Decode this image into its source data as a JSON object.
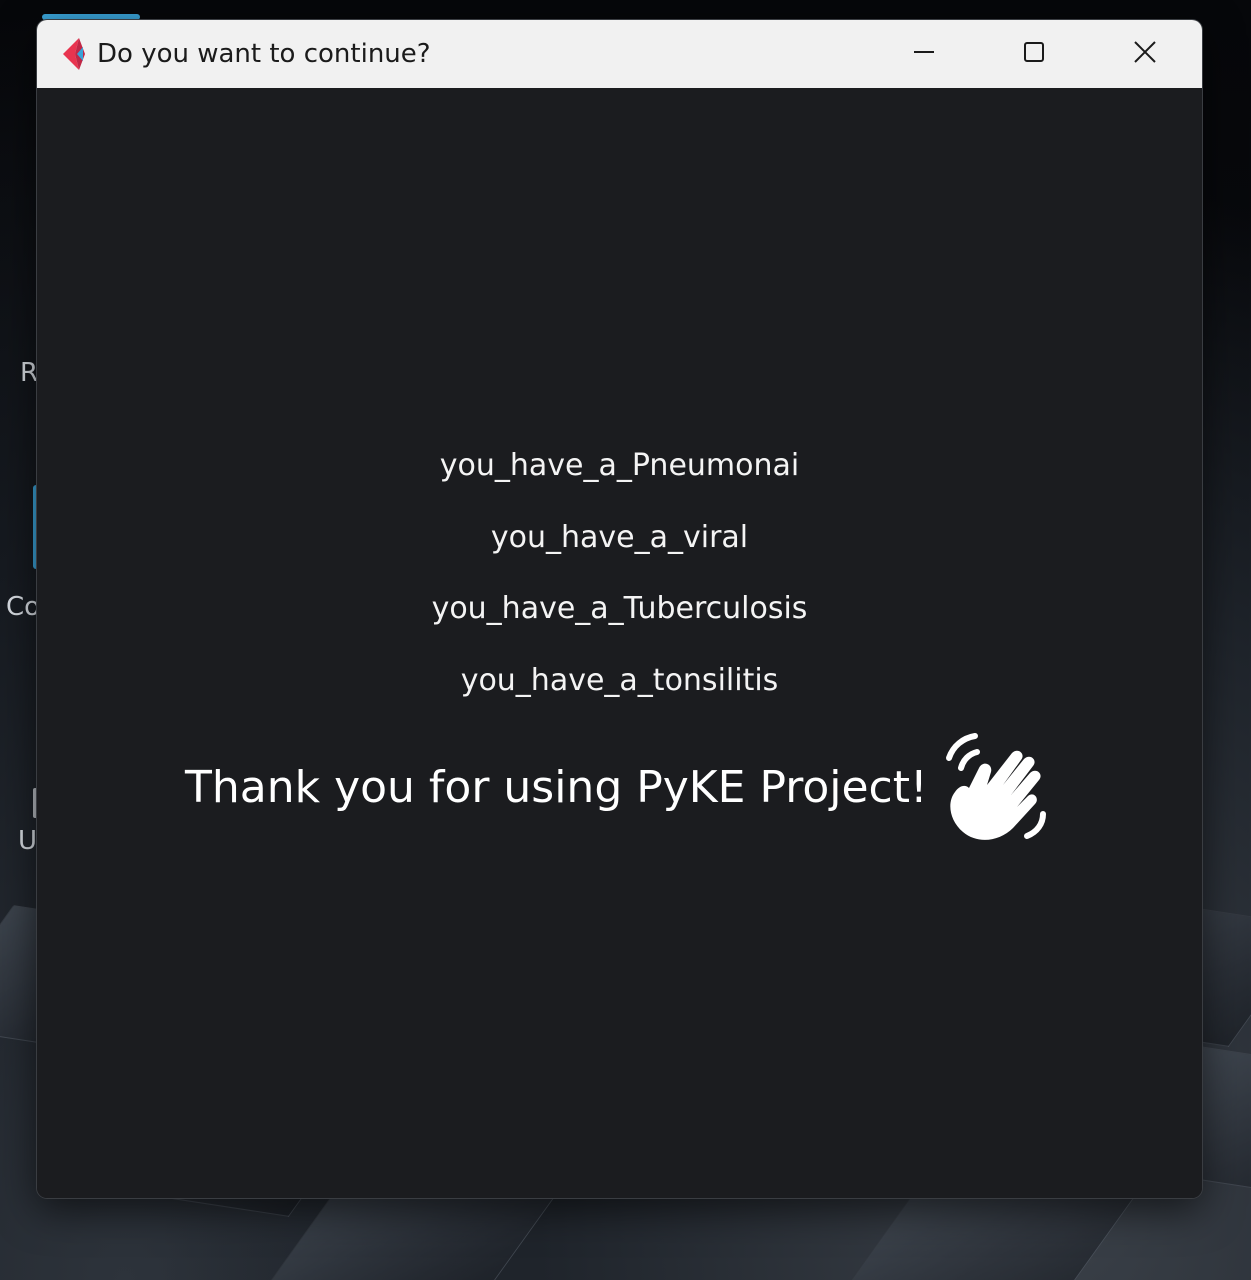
{
  "desktop": {
    "labels": [
      "R",
      "Co",
      "U"
    ]
  },
  "window": {
    "title": "Do you want to continue?",
    "app_icon": "pyke-app-icon",
    "controls": {
      "minimize_icon": "minimize-icon",
      "maximize_icon": "maximize-icon",
      "close_icon": "close-icon"
    }
  },
  "results": [
    "you_have_a_Pneumonai",
    "you_have_a_viral",
    "you_have_a_Tuberculosis",
    "you_have_a_tonsilitis"
  ],
  "farewell": {
    "message": "Thank you for using PyKE Project!",
    "icon": "waving-hand-icon"
  },
  "colors": {
    "titlebar": "#f1f1f1",
    "content_bg": "#1b1c1f",
    "text": "#ffffff",
    "icon_red": "#e8344f",
    "icon_blue": "#3aa3d8"
  }
}
